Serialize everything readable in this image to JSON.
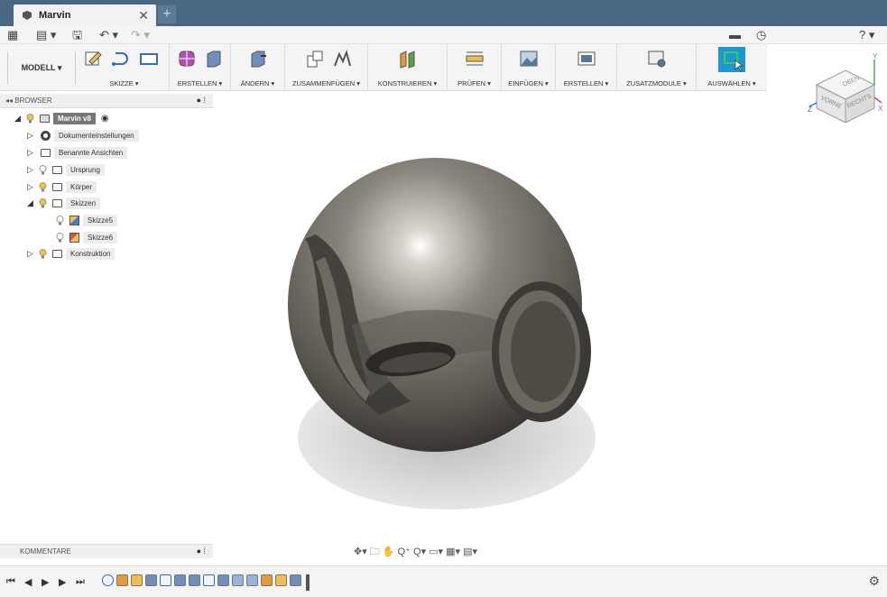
{
  "tab": {
    "title": "Marvin",
    "close": "✕",
    "new": "+"
  },
  "qab": {
    "grid": "▦",
    "file": "▤ ▾",
    "save": "🖫",
    "undo": "↶ ▾",
    "redo": "↷ ▾",
    "chat": "▬",
    "clock": "◷",
    "help": "? ▾"
  },
  "toolbar": {
    "mode_label": "MODELL ▾",
    "groups": [
      {
        "label": "SKIZZE ▾"
      },
      {
        "label": "ERSTELLEN ▾"
      },
      {
        "label": "ÄNDERN ▾"
      },
      {
        "label": "ZUSAMMENFÜGEN ▾"
      },
      {
        "label": "KONSTRUIEREN ▾"
      },
      {
        "label": "PRÜFEN ▾"
      },
      {
        "label": "EINFÜGEN ▾"
      },
      {
        "label": "ERSTELLEN ▾"
      },
      {
        "label": "ZUSATZMODULE ▾"
      },
      {
        "label": "AUSWÄHLEN ▾"
      }
    ]
  },
  "browser": {
    "header": "BROWSER",
    "collapse": "◂◂",
    "items": [
      {
        "label": "Marvin v8"
      },
      {
        "label": "Dokumenteinstellungen"
      },
      {
        "label": "Benannte Ansichten"
      },
      {
        "label": "Ursprung"
      },
      {
        "label": "Körper"
      },
      {
        "label": "Skizzen"
      },
      {
        "label": "Skizze5"
      },
      {
        "label": "Skizze6"
      },
      {
        "label": "Konstruktion"
      }
    ]
  },
  "viewcube": {
    "top": "OBEN",
    "front": "VORNE",
    "right": "RECHTS",
    "axis_x": "X",
    "axis_y": "Y",
    "axis_z": "Z"
  },
  "comments": {
    "header": "KOMMENTARE"
  },
  "navbar": {
    "tools": "✥▾ 🗀 ✋ Q⁺ Q▾   ▭▾ ▦▾ ▤▾"
  },
  "timeline": {
    "first": "⏮",
    "prev": "◀",
    "play": "▶",
    "next": "▶",
    "last": "⏭",
    "settings": "⚙"
  }
}
